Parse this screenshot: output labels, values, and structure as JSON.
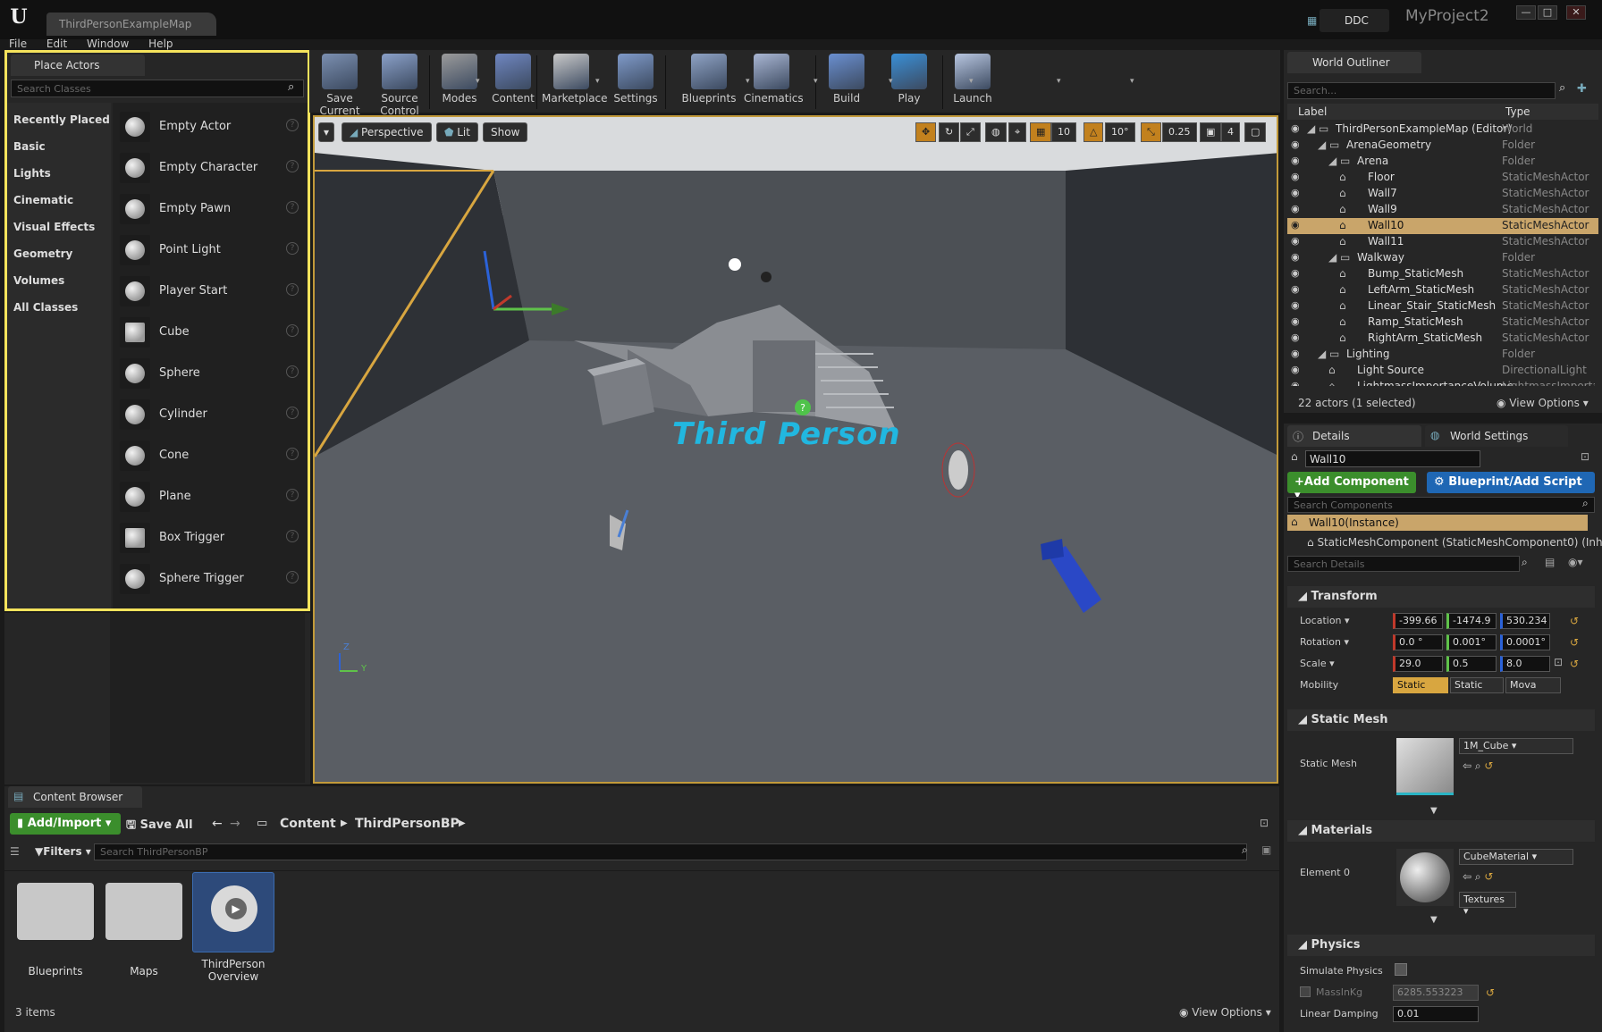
{
  "titlebar": {
    "tab": "ThirdPersonExampleMap",
    "ddc": "DDC",
    "project": "MyProject2",
    "window_buttons": [
      "—",
      "□",
      "✕"
    ]
  },
  "menu": [
    "File",
    "Edit",
    "Window",
    "Help"
  ],
  "toolbar": {
    "buttons": [
      {
        "label": "Save Current",
        "icon": "save-icon"
      },
      {
        "label": "Source Control",
        "icon": "source-control-icon"
      },
      {
        "label": "Modes",
        "icon": "modes-icon"
      },
      {
        "label": "Content",
        "icon": "content-icon"
      },
      {
        "label": "Marketplace",
        "icon": "marketplace-icon"
      },
      {
        "label": "Settings",
        "icon": "settings-icon"
      },
      {
        "label": "Blueprints",
        "icon": "blueprints-icon"
      },
      {
        "label": "Cinematics",
        "icon": "cinematics-icon"
      },
      {
        "label": "Build",
        "icon": "build-icon"
      },
      {
        "label": "Play",
        "icon": "play-icon"
      },
      {
        "label": "Launch",
        "icon": "launch-icon"
      }
    ]
  },
  "place_actors": {
    "tab": "Place Actors",
    "search_placeholder": "Search Classes",
    "categories": [
      "Recently Placed",
      "Basic",
      "Lights",
      "Cinematic",
      "Visual Effects",
      "Geometry",
      "Volumes",
      "All Classes"
    ],
    "actors": [
      "Empty Actor",
      "Empty Character",
      "Empty Pawn",
      "Point Light",
      "Player Start",
      "Cube",
      "Sphere",
      "Cylinder",
      "Cone",
      "Plane",
      "Box Trigger",
      "Sphere Trigger"
    ],
    "help": "?"
  },
  "viewport": {
    "perspective": "Perspective",
    "lit": "Lit",
    "show": "Show",
    "grid_snap": "10",
    "rot_snap": "10°",
    "scale_snap": "0.25",
    "cam_speed": "4",
    "scene_text": "Third Person",
    "axis_z": "Z",
    "axis_y": "Y"
  },
  "world_outliner": {
    "tab": "World Outliner",
    "search_placeholder": "Search...",
    "col_label": "Label",
    "col_type": "Type",
    "rows": [
      {
        "name": "ThirdPersonExampleMap (Editor)",
        "type": "World",
        "indent": 0
      },
      {
        "name": "ArenaGeometry",
        "type": "Folder",
        "indent": 1
      },
      {
        "name": "Arena",
        "type": "Folder",
        "indent": 2
      },
      {
        "name": "Floor",
        "type": "StaticMeshActor",
        "indent": 3
      },
      {
        "name": "Wall7",
        "type": "StaticMeshActor",
        "indent": 3
      },
      {
        "name": "Wall9",
        "type": "StaticMeshActor",
        "indent": 3
      },
      {
        "name": "Wall10",
        "type": "StaticMeshActor",
        "indent": 3,
        "selected": true
      },
      {
        "name": "Wall11",
        "type": "StaticMeshActor",
        "indent": 3
      },
      {
        "name": "Walkway",
        "type": "Folder",
        "indent": 2
      },
      {
        "name": "Bump_StaticMesh",
        "type": "StaticMeshActor",
        "indent": 3
      },
      {
        "name": "LeftArm_StaticMesh",
        "type": "StaticMeshActor",
        "indent": 3
      },
      {
        "name": "Linear_Stair_StaticMesh",
        "type": "StaticMeshActor",
        "indent": 3
      },
      {
        "name": "Ramp_StaticMesh",
        "type": "StaticMeshActor",
        "indent": 3
      },
      {
        "name": "RightArm_StaticMesh",
        "type": "StaticMeshActor",
        "indent": 3
      },
      {
        "name": "Lighting",
        "type": "Folder",
        "indent": 1
      },
      {
        "name": "Light Source",
        "type": "DirectionalLight",
        "indent": 2
      },
      {
        "name": "LightmassImportanceVolume",
        "type": "LightmassImportanceVolume",
        "indent": 2
      }
    ],
    "status": "22 actors (1 selected)",
    "view_options": "View Options"
  },
  "details": {
    "tab": "Details",
    "tab2": "World Settings",
    "name_value": "Wall10",
    "add_component": "Add Component",
    "blueprint": "Blueprint/Add Script",
    "search_components": "Search Components",
    "instance": "Wall10(Instance)",
    "component": "StaticMeshComponent (StaticMeshComponent0) (Inh",
    "search_details": "Search Details",
    "transform": "Transform",
    "location_label": "Location",
    "rotation_label": "Rotation",
    "scale_label": "Scale",
    "mobility_label": "Mobility",
    "location": [
      "-399.66",
      "-1474.9",
      "530.234"
    ],
    "rotation": [
      "0.0 °",
      "0.001°",
      "0.0001°"
    ],
    "scale": [
      "29.0",
      "0.5",
      "8.0"
    ],
    "mobility": [
      "Static",
      "Static",
      "Mova"
    ],
    "static_mesh_section": "Static Mesh",
    "static_mesh_label": "Static Mesh",
    "static_mesh_value": "1M_Cube",
    "materials_section": "Materials",
    "element0_label": "Element 0",
    "material_value": "CubeMaterial",
    "textures": "Textures",
    "physics_section": "Physics",
    "simulate_physics": "Simulate Physics",
    "mass_label": "MassInKg",
    "mass_value": "6285.553223",
    "linear_damping_label": "Linear Damping",
    "linear_damping_value": "0.01"
  },
  "content_browser": {
    "tab": "Content Browser",
    "add_import": "Add/Import",
    "save_all": "Save All",
    "path": [
      "Content",
      "ThirdPersonBP"
    ],
    "filters": "Filters",
    "search_placeholder": "Search ThirdPersonBP",
    "items": [
      "Blueprints",
      "Maps",
      "ThirdPerson Overview"
    ],
    "count": "3 items",
    "view_options": "View Options"
  },
  "colors": {
    "selection": "#f5e35c",
    "viewport_border": "#c29a3a",
    "add_green": "#3b8e2c",
    "blueprint_blue": "#1f67b4",
    "selected_row": "#c9a56a"
  }
}
